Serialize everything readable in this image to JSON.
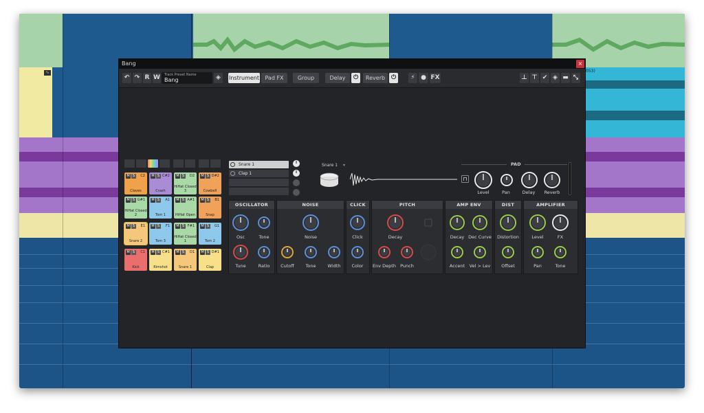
{
  "window": {
    "title": "Bang",
    "close_glyph": "×"
  },
  "track_text": "053)",
  "toolbar": {
    "undo_glyph": "↶",
    "redo_glyph": "↷",
    "r_label": "R",
    "w_label": "W",
    "preset_caption": "Track Preset Name",
    "preset_name": "Bang",
    "tabs": {
      "instrument": "Instrument",
      "pad_fx": "Pad FX",
      "group": "Group",
      "delay": "Delay",
      "reverb": "Reverb"
    },
    "power_glyph": "⏻",
    "fx_label": "FX"
  },
  "pads": [
    {
      "note": "C2",
      "name": "Claves",
      "color": "#f0a24a"
    },
    {
      "note": "C#2",
      "name": "Crash",
      "color": "#a98bd6"
    },
    {
      "note": "D2",
      "name": "HiHat Closed 3",
      "color": "#a9d9a6"
    },
    {
      "note": "D#2",
      "name": "Cowbell",
      "color": "#f0a25a"
    },
    {
      "note": "G#1",
      "name": "HiHat Closed 2",
      "color": "#a9d9a6"
    },
    {
      "note": "A1",
      "name": "Tom 1",
      "color": "#8ec8ea"
    },
    {
      "note": "A#1",
      "name": "HiHat Open",
      "color": "#a9d9a6"
    },
    {
      "note": "B1",
      "name": "Snap",
      "color": "#f0a25a"
    },
    {
      "note": "E1",
      "name": "Snare 2",
      "color": "#f5c77a"
    },
    {
      "note": "F1",
      "name": "Tom 3",
      "color": "#8ec8ea"
    },
    {
      "note": "F#1",
      "name": "HiHat Closed 1",
      "color": "#a9d9a6"
    },
    {
      "note": "G1",
      "name": "Tom 2",
      "color": "#8ec8ea"
    },
    {
      "note": "C1",
      "name": "Kick",
      "color": "#ea6e6e"
    },
    {
      "note": "C#1",
      "name": "Rimshot",
      "color": "#f8e08a"
    },
    {
      "note": "D1",
      "name": "Snare 1",
      "color": "#f5c77a"
    },
    {
      "note": "D#1",
      "name": "Clap",
      "color": "#f8e08a"
    }
  ],
  "pad_ms": {
    "m": "M",
    "s": "S"
  },
  "instruments": [
    "Snare 1",
    "Clap 1"
  ],
  "selected_instrument": "Snare 1",
  "dropdown_glyph": "▾",
  "pad_section": {
    "title": "PAD",
    "knobs": [
      "Level",
      "Pan",
      "Delay",
      "Reverb"
    ]
  },
  "sections": {
    "oscillator": {
      "title": "OSCILLATOR",
      "knobs": [
        "Osc",
        "Tone",
        "Tune",
        "Ratio"
      ]
    },
    "noise": {
      "title": "NOISE",
      "knobs": [
        "Noise",
        "Cutoff",
        "Tone",
        "Width"
      ]
    },
    "click": {
      "title": "CLICK",
      "knobs": [
        "Click",
        "Color"
      ]
    },
    "pitch": {
      "title": "PITCH",
      "knobs": [
        "Decay",
        "Env Depth",
        "Punch"
      ]
    },
    "amp_env": {
      "title": "AMP ENV",
      "knobs": [
        "Decay",
        "Dec Curve",
        "Accent",
        "Vel > Lev"
      ]
    },
    "dist": {
      "title": "DIST",
      "knobs": [
        "Distortion",
        "Offset"
      ]
    },
    "amplifier": {
      "title": "AMPLIFIER",
      "knobs": [
        "Level",
        "FX",
        "Pan",
        "Tone"
      ]
    }
  },
  "colors": {
    "panel": "#232427",
    "knob_blue": "#5b8fd6",
    "knob_red": "#d64a4a",
    "knob_orange": "#e0a43a",
    "knob_green": "#9acb4a",
    "knob_white": "#e8e8e8"
  }
}
